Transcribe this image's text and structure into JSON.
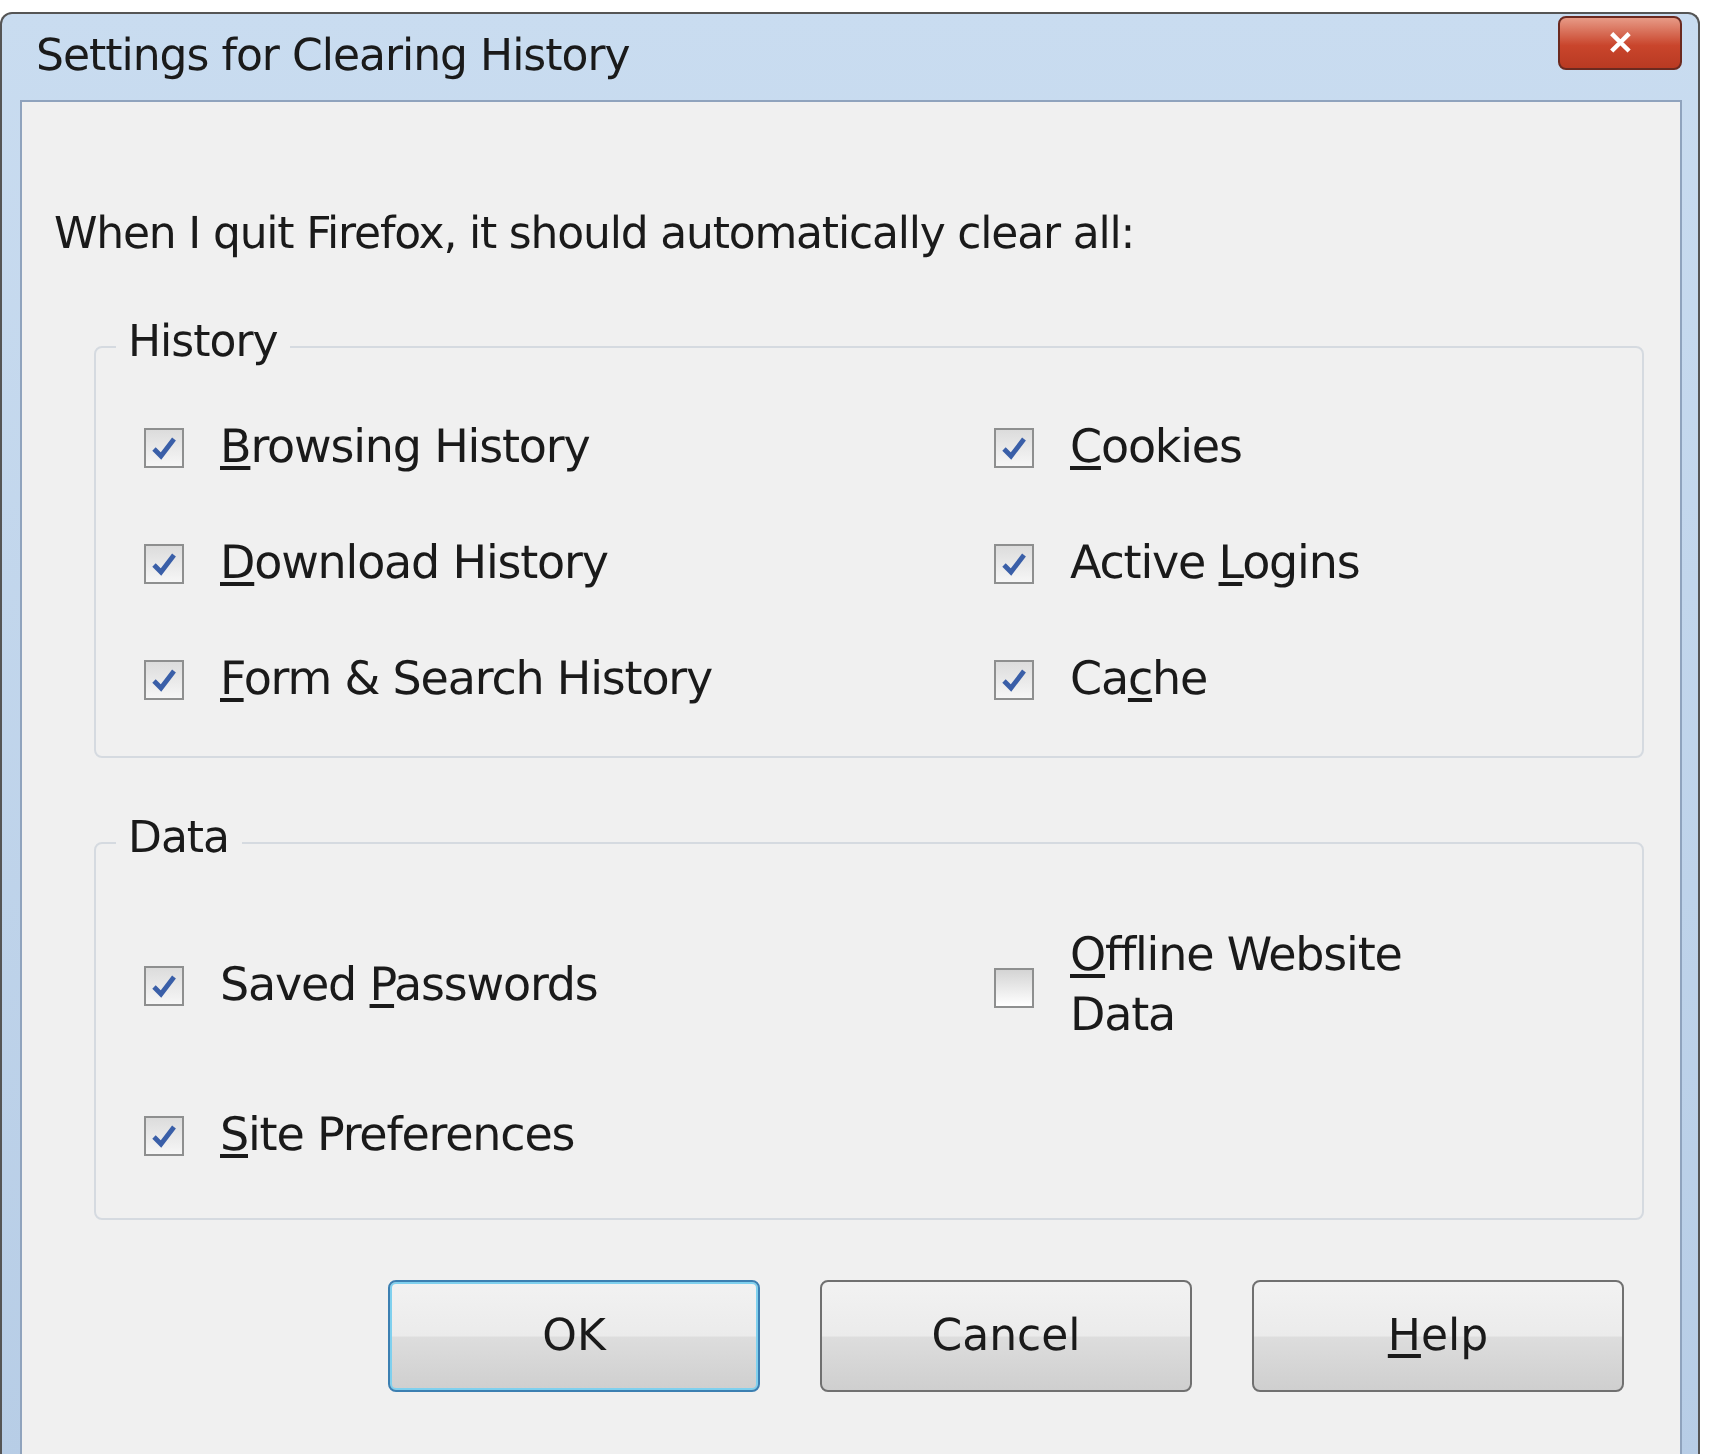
{
  "window": {
    "title": "Settings for Clearing History",
    "close": "✕"
  },
  "instruction": "When I quit Firefox, it should automatically clear all:",
  "groups": [
    {
      "title": "History",
      "columns": [
        [
          {
            "key": "B",
            "after": "rowsing History",
            "checked": true
          },
          {
            "key": "D",
            "after": "ownload History",
            "checked": true
          },
          {
            "key": "F",
            "after": "orm & Search History",
            "checked": true
          }
        ],
        [
          {
            "key": "C",
            "after": "ookies",
            "checked": true
          },
          {
            "before": "Active ",
            "key": "L",
            "after": "ogins",
            "checked": true
          },
          {
            "before": "Ca",
            "key": "c",
            "after": "he",
            "checked": true
          }
        ]
      ]
    },
    {
      "title": "Data",
      "columns": [
        [
          {
            "before": "Saved ",
            "key": "P",
            "after": "asswords",
            "checked": true
          },
          {
            "key": "S",
            "after": "ite Preferences",
            "checked": true
          }
        ],
        [
          {
            "key": "O",
            "after": "ffline Website Data",
            "checked": false
          }
        ]
      ]
    }
  ],
  "buttons": [
    {
      "before": "OK",
      "default": true
    },
    {
      "before": "Cancel",
      "default": false
    },
    {
      "key": "H",
      "after": "elp",
      "default": false
    }
  ]
}
